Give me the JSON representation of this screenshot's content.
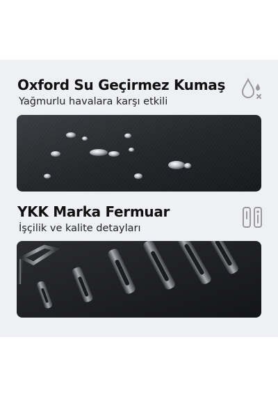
{
  "section1": {
    "title": "Oxford Su Geçirmez Kumaş",
    "subtitle": "Yağmurlu havalara karşı etkili",
    "icon": "water-drops-icon"
  },
  "section2": {
    "title": "YKK Marka Fermuar",
    "subtitle": "İşçilik ve kalite detayları",
    "icon": "zipper-icon"
  },
  "colors": {
    "panel_background": "#eef0f3",
    "page_background": "#ffffff",
    "text": "#111111",
    "icon": "#9a9a9a"
  }
}
